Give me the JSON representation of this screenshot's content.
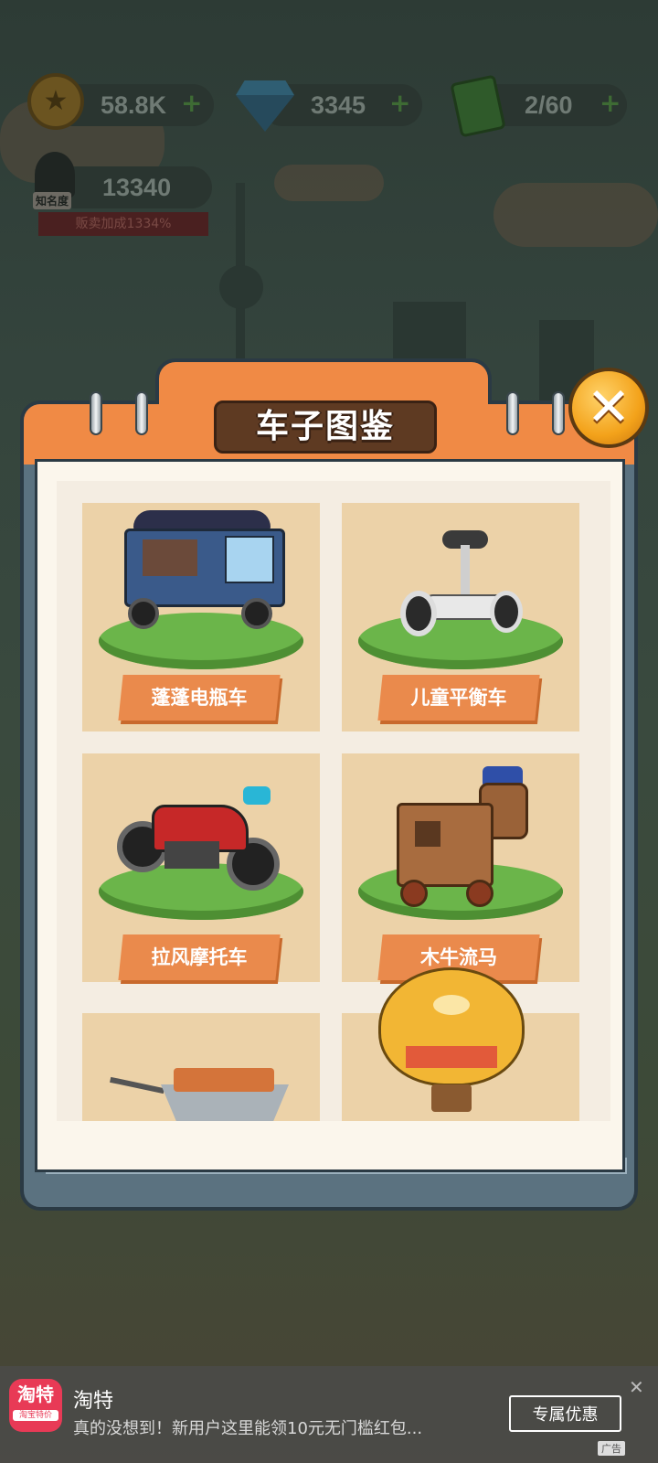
{
  "hud": {
    "coins": "58.8K",
    "gems": "3345",
    "energy": "2/60",
    "fame_label": "知名度",
    "fame_value": "13340",
    "fame_bonus": "贩卖加成1334%"
  },
  "dialog": {
    "title": "车子图鉴",
    "items": [
      {
        "label": "蓬蓬电瓶车",
        "icon": "tuk-tuk-icon"
      },
      {
        "label": "儿童平衡车",
        "icon": "balance-scooter-icon"
      },
      {
        "label": "拉风摩托车",
        "icon": "motorcycle-icon"
      },
      {
        "label": "木牛流马",
        "icon": "wooden-horse-icon"
      },
      {
        "label": "",
        "icon": "wheelbarrow-icon"
      },
      {
        "label": "",
        "icon": "bear-balloon-icon"
      }
    ]
  },
  "ad": {
    "logo_big": "淘特",
    "logo_small": "淘宝特价",
    "title": "淘特",
    "description": "真的没想到！新用户这里能领10元无门槛红包...",
    "button": "专属优惠",
    "tag": "广告",
    "close": "✕"
  },
  "colors": {
    "dialog_orange": "#f08a45",
    "card_tan": "#ecd2a8",
    "label_orange": "#ea8a4c",
    "close_gold": "#f3a21a"
  }
}
